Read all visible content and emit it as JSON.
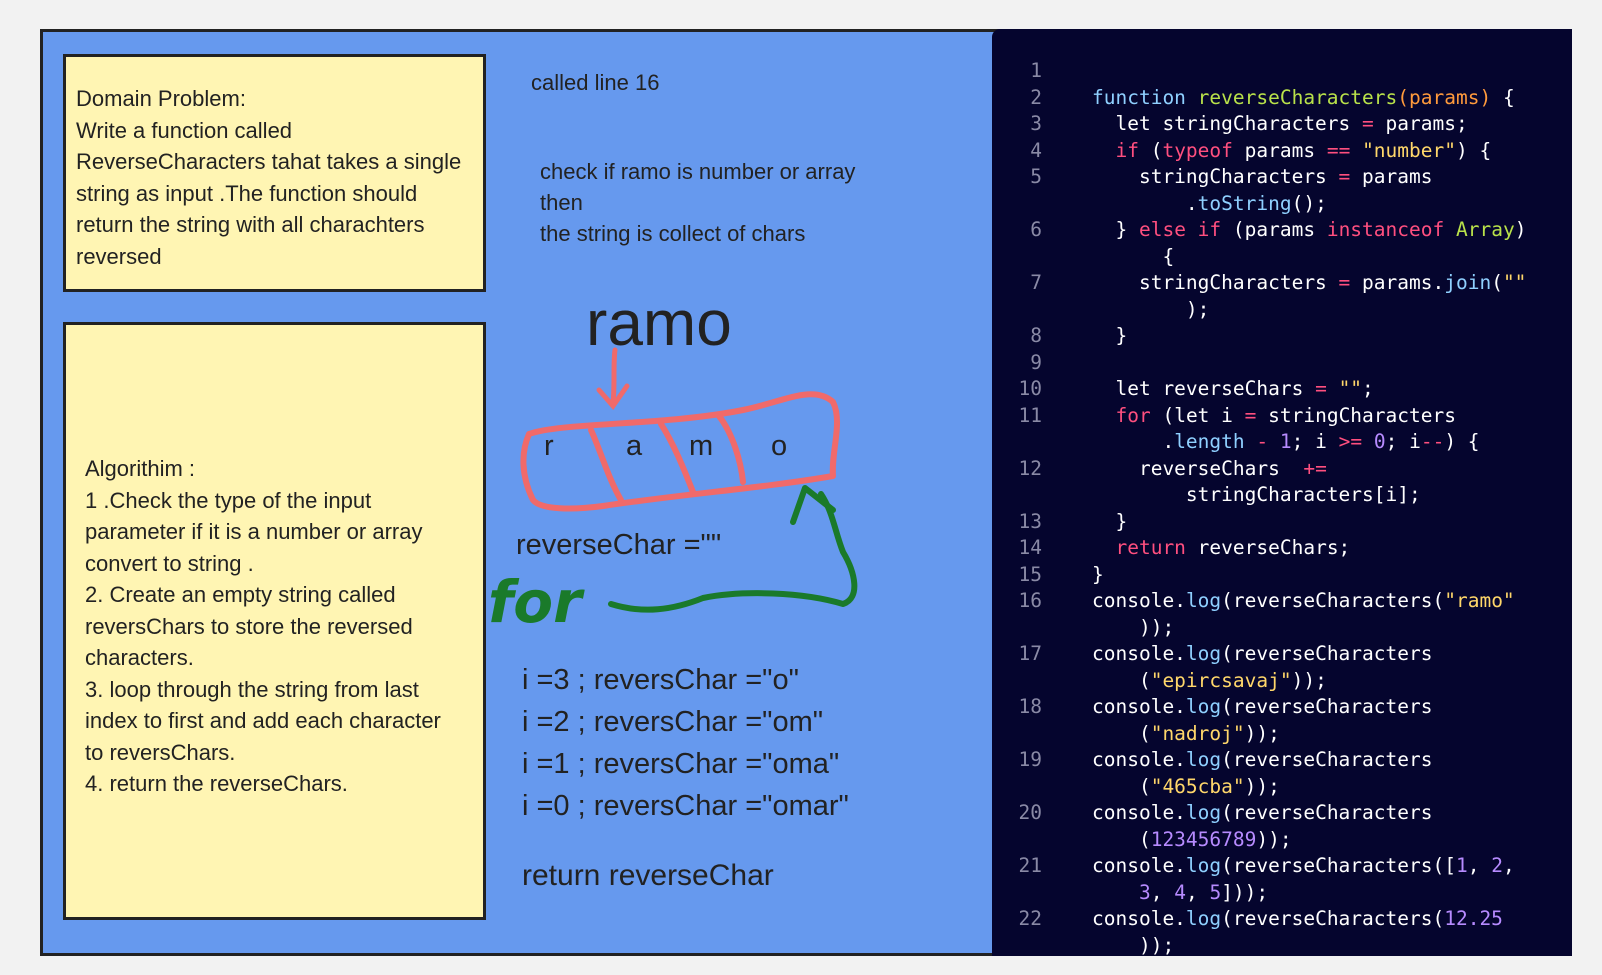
{
  "notes": {
    "domain": "Domain Problem:\nWrite a function called\nReverseCharacters tahat takes a single\nstring as input .The function should\nreturn the string with all charachters\nreversed",
    "algorithm": "Algorithim :\n1 .Check the type of the input\nparameter if it is a number  or array\nconvert to string .\n2. Create an empty string called\nreversChars to store the reversed\ncharacters.\n3. loop  through the string from last\nindex to first and add each character\n to reversChars.\n4. return the reverseChars."
  },
  "annotations": {
    "called": "called line  16",
    "check": "check if ramo is number or array\nthen\nthe string is collect of chars",
    "word": "ramo",
    "chars": [
      "r",
      "a",
      "m",
      "o"
    ],
    "init": "reverseChar =\"\"",
    "loop_word": "for",
    "iterations": [
      "i =3 ; reversChar =\"o\"",
      "i =2 ; reversChar =\"om\"",
      "i =1 ; reversChar =\"oma\"",
      "i =0 ; reversChar =\"omar\""
    ],
    "return": "return  reverseChar"
  },
  "colors": {
    "board": "#6699ee",
    "sticky": "#fff5b3",
    "code_bg": "#05052e",
    "red_ink": "#f06a6a",
    "green_ink": "#1a7a2a"
  },
  "code": {
    "line_numbers": [
      "1",
      "2",
      "3",
      "4",
      "5",
      "6",
      "7",
      "8",
      "9",
      "10",
      "11",
      "12",
      "13",
      "14",
      "15",
      "16",
      "17",
      "18",
      "19",
      "20",
      "21",
      "22"
    ],
    "lines": [
      [],
      [
        [
          "function ",
          "kw-fn"
        ],
        [
          "reverseCharacters",
          "fg"
        ],
        [
          "(",
          "par"
        ],
        [
          "params",
          "par"
        ],
        [
          ")",
          "par"
        ],
        [
          " {",
          ""
        ]
      ],
      [
        [
          "  let stringCharacters ",
          ""
        ],
        [
          "=",
          "op"
        ],
        [
          " params;",
          ""
        ]
      ],
      [
        [
          "  ",
          ""
        ],
        [
          "if",
          "kw"
        ],
        [
          " (",
          ""
        ],
        [
          "typeof",
          "kw"
        ],
        [
          " params ",
          ""
        ],
        [
          "==",
          "op"
        ],
        [
          " ",
          ""
        ],
        [
          "\"number\"",
          "str"
        ],
        [
          ") {",
          ""
        ]
      ],
      [
        [
          "    stringCharacters ",
          ""
        ],
        [
          "=",
          "op"
        ],
        [
          " params",
          ""
        ]
      ],
      [
        [
          "        .",
          ""
        ],
        [
          "toString",
          "fn"
        ],
        [
          "();",
          ""
        ]
      ],
      [
        [
          "  } ",
          ""
        ],
        [
          "else if",
          "kw"
        ],
        [
          " (params ",
          ""
        ],
        [
          "instanceof",
          "kw"
        ],
        [
          " ",
          ""
        ],
        [
          "Array",
          "fg"
        ],
        [
          ")",
          ""
        ]
      ],
      [
        [
          "      {",
          ""
        ]
      ],
      [
        [
          "    stringCharacters ",
          ""
        ],
        [
          "=",
          "op"
        ],
        [
          " params.",
          ""
        ],
        [
          "join",
          "fn"
        ],
        [
          "(",
          ""
        ],
        [
          "\"\"",
          "str"
        ]
      ],
      [
        [
          "        );",
          ""
        ]
      ],
      [
        [
          "  }",
          ""
        ]
      ],
      [],
      [
        [
          "  let reverseChars ",
          ""
        ],
        [
          "=",
          "op"
        ],
        [
          " ",
          ""
        ],
        [
          "\"\"",
          "str"
        ],
        [
          ";",
          ""
        ]
      ],
      [
        [
          "  ",
          ""
        ],
        [
          "for",
          "kw"
        ],
        [
          " (let i ",
          ""
        ],
        [
          "=",
          "op"
        ],
        [
          " stringCharacters",
          ""
        ]
      ],
      [
        [
          "      .",
          ""
        ],
        [
          "length",
          "fn"
        ],
        [
          " ",
          ""
        ],
        [
          "-",
          "op"
        ],
        [
          " ",
          ""
        ],
        [
          "1",
          "num"
        ],
        [
          "; i ",
          ""
        ],
        [
          ">=",
          "op"
        ],
        [
          " ",
          ""
        ],
        [
          "0",
          "num"
        ],
        [
          "; i",
          ""
        ],
        [
          "--",
          "op"
        ],
        [
          ") {",
          ""
        ]
      ],
      [
        [
          "    reverseChars  ",
          ""
        ],
        [
          "+=",
          "op"
        ]
      ],
      [
        [
          "        stringCharacters[i];",
          ""
        ]
      ],
      [
        [
          "  }",
          ""
        ]
      ],
      [
        [
          "  ",
          ""
        ],
        [
          "return",
          "kw"
        ],
        [
          " reverseChars;",
          ""
        ]
      ],
      [
        [
          "}",
          ""
        ]
      ],
      [
        [
          "console",
          ""
        ],
        [
          ".",
          ""
        ],
        [
          "log",
          "fn"
        ],
        [
          "(reverseCharacters(",
          ""
        ],
        [
          "\"ramo\"",
          "str"
        ]
      ],
      [
        [
          "    ));",
          ""
        ]
      ],
      [
        [
          "console.",
          ""
        ],
        [
          "log",
          "fn"
        ],
        [
          "(reverseCharacters",
          ""
        ]
      ],
      [
        [
          "    (",
          ""
        ],
        [
          "\"epircsavaj\"",
          "str"
        ],
        [
          "));",
          ""
        ]
      ],
      [
        [
          "console.",
          ""
        ],
        [
          "log",
          "fn"
        ],
        [
          "(reverseCharacters",
          ""
        ]
      ],
      [
        [
          "    (",
          ""
        ],
        [
          "\"nadroj\"",
          "str"
        ],
        [
          "));",
          ""
        ]
      ],
      [
        [
          "console.",
          ""
        ],
        [
          "log",
          "fn"
        ],
        [
          "(reverseCharacters",
          ""
        ]
      ],
      [
        [
          "    (",
          ""
        ],
        [
          "\"465cba\"",
          "str"
        ],
        [
          "));",
          ""
        ]
      ],
      [
        [
          "console.",
          ""
        ],
        [
          "log",
          "fn"
        ],
        [
          "(reverseCharacters",
          ""
        ]
      ],
      [
        [
          "    (",
          ""
        ],
        [
          "123456789",
          "num"
        ],
        [
          "));",
          ""
        ]
      ],
      [
        [
          "console.",
          ""
        ],
        [
          "log",
          "fn"
        ],
        [
          "(reverseCharacters([",
          ""
        ],
        [
          "1",
          "num"
        ],
        [
          ", ",
          ""
        ],
        [
          "2",
          "num"
        ],
        [
          ",",
          ""
        ]
      ],
      [
        [
          "    ",
          ""
        ],
        [
          "3",
          "num"
        ],
        [
          ", ",
          ""
        ],
        [
          "4",
          "num"
        ],
        [
          ", ",
          ""
        ],
        [
          "5",
          "num"
        ],
        [
          "]));",
          ""
        ]
      ],
      [
        [
          "console.",
          ""
        ],
        [
          "log",
          "fn"
        ],
        [
          "(reverseCharacters(",
          ""
        ],
        [
          "12.25",
          "num"
        ]
      ],
      [
        [
          "    ));",
          ""
        ]
      ]
    ]
  }
}
